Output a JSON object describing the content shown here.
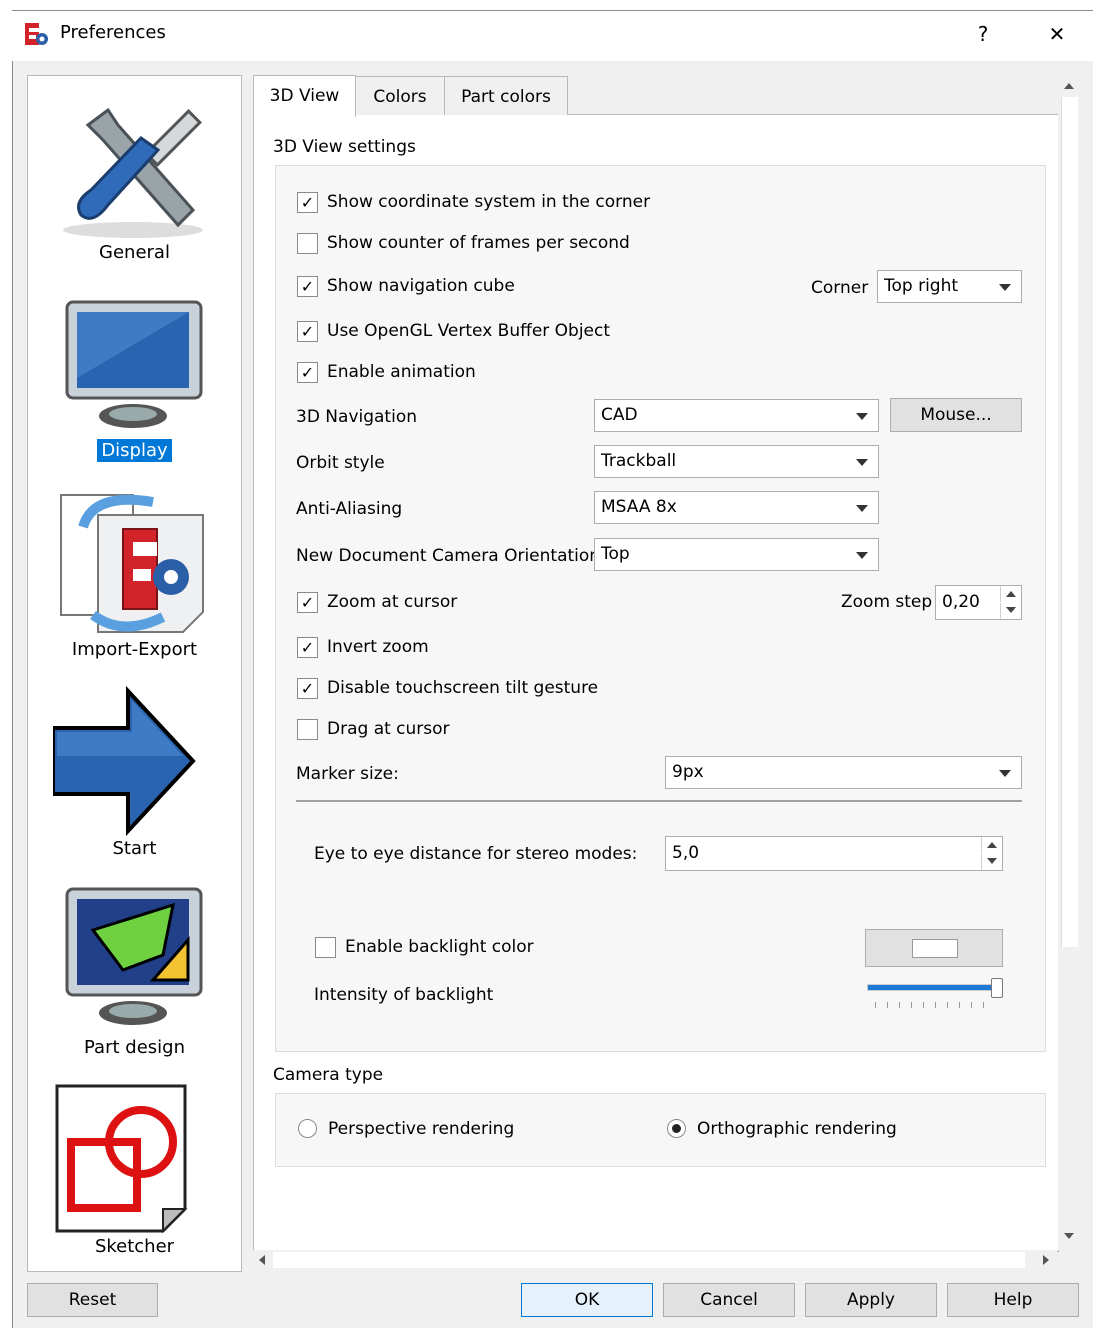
{
  "window": {
    "title": "Preferences",
    "help_glyph": "?",
    "close_glyph": "✕",
    "app_icon": "freecad-icon"
  },
  "sidebar": {
    "items": [
      {
        "label": "General",
        "icon": "tools-icon",
        "selected": false
      },
      {
        "label": "Display",
        "icon": "monitor-icon",
        "selected": true
      },
      {
        "label": "Import-Export",
        "icon": "import-export-icon",
        "selected": false
      },
      {
        "label": "Start",
        "icon": "arrow-right-icon",
        "selected": false
      },
      {
        "label": "Part design",
        "icon": "part-design-icon",
        "selected": false
      },
      {
        "label": "Sketcher",
        "icon": "sketcher-icon",
        "selected": false
      }
    ]
  },
  "tabs": [
    {
      "label": "3D View",
      "active": true
    },
    {
      "label": "Colors",
      "active": false
    },
    {
      "label": "Part colors",
      "active": false
    }
  ],
  "view_settings": {
    "title": "3D View settings",
    "show_coord_system": {
      "label": "Show coordinate system in the corner",
      "checked": true
    },
    "show_fps": {
      "label": "Show counter of frames per second",
      "checked": false
    },
    "show_nav_cube": {
      "label": "Show navigation cube",
      "checked": true
    },
    "corner_label": "Corner",
    "corner_value": "Top right",
    "use_vbo": {
      "label": "Use OpenGL Vertex Buffer Object",
      "checked": true
    },
    "enable_animation": {
      "label": "Enable animation",
      "checked": true
    },
    "navigation_label": "3D Navigation",
    "navigation_value": "CAD",
    "mouse_button": "Mouse...",
    "orbit_label": "Orbit style",
    "orbit_value": "Trackball",
    "aa_label": "Anti-Aliasing",
    "aa_value": "MSAA 8x",
    "camera_orient_label": "New Document Camera Orientation",
    "camera_orient_value": "Top",
    "zoom_at_cursor": {
      "label": "Zoom at cursor",
      "checked": true
    },
    "zoom_step_label": "Zoom step",
    "zoom_step_value": "0,20",
    "invert_zoom": {
      "label": "Invert zoom",
      "checked": true
    },
    "disable_tilt": {
      "label": "Disable touchscreen tilt gesture",
      "checked": true
    },
    "drag_at_cursor": {
      "label": "Drag at cursor",
      "checked": false
    },
    "marker_label": "Marker size:",
    "marker_value": "9px",
    "eye_label": "Eye to eye distance for stereo modes:",
    "eye_value": "5,0",
    "backlight": {
      "label": "Enable backlight color",
      "checked": false
    },
    "backlight_color": "#ffffff",
    "intensity_label": "Intensity of backlight",
    "intensity_level": 1.0
  },
  "camera": {
    "title": "Camera type",
    "perspective": {
      "label": "Perspective rendering",
      "selected": false
    },
    "orthographic": {
      "label": "Orthographic rendering",
      "selected": true
    }
  },
  "buttons": {
    "reset": "Reset",
    "ok": "OK",
    "cancel": "Cancel",
    "apply": "Apply",
    "help": "Help"
  },
  "colors": {
    "accent": "#0078d7",
    "slider": "#1e78d6"
  }
}
